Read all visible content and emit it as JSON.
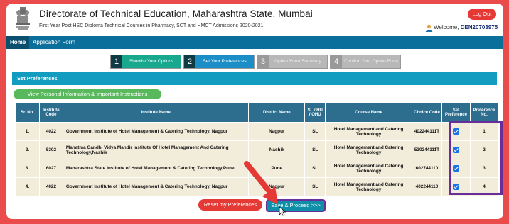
{
  "header": {
    "title": "Directorate of Technical Education, Maharashtra State, Mumbai",
    "subtitle": "First Year Post HSC Diploma Technical Courses in Pharmacy, SCT and HMCT Admissions 2020-2021",
    "logout_label": "Log Out",
    "welcome_label": "Welcome,",
    "user_id": "DEN20703975"
  },
  "nav": {
    "home_label": "Home",
    "application_form_label": "Application Form"
  },
  "steps": [
    {
      "num": "1",
      "label": "Shortlist Your Options",
      "state": "done"
    },
    {
      "num": "2",
      "label": "Set Your Preferences",
      "state": "active"
    },
    {
      "num": "3",
      "label": "Option Form Summary",
      "state": "pending"
    },
    {
      "num": "4",
      "label": "Confirm Your Option Form",
      "state": "pending"
    }
  ],
  "panel": {
    "title": "Set Preferences",
    "instructions_button": "View Personal Information & Important Instructions"
  },
  "table": {
    "headers": [
      "Sr. No.",
      "Institute Code",
      "Institute Name",
      "District Name",
      "SL / HU / OHU",
      "Course Name",
      "Choice Code",
      "Set Preference",
      "Preference No."
    ],
    "rows": [
      {
        "sr": "1.",
        "code": "4022",
        "name": "Government Institute of Hotel Management & Catering Technology, Nagpur",
        "district": "Nagpur",
        "type": "SL",
        "course": "Hotel Management and Catering Technology",
        "choice": "402244111T",
        "checked": true,
        "pref": "1"
      },
      {
        "sr": "2.",
        "code": "5302",
        "name": "Mahatma Gandhi Vidya Mandir Institute Of Hotel Management And Catering Technology,Nashik",
        "district": "Nashik",
        "type": "SL",
        "course": "Hotel Management and Catering Technology",
        "choice": "530244111T",
        "checked": true,
        "pref": "2"
      },
      {
        "sr": "3.",
        "code": "6027",
        "name": "Maharashtra State Institute of Hotel Management & Catering Technology,Pune",
        "district": "Pune",
        "type": "SL",
        "course": "Hotel Management and Catering Technology",
        "choice": "602744110",
        "checked": true,
        "pref": "3"
      },
      {
        "sr": "4.",
        "code": "4022",
        "name": "Government Institute of Hotel Management & Catering Technology, Nagpur",
        "district": "Nagpur",
        "type": "SL",
        "course": "Hotel Management and Catering Technology",
        "choice": "402244110",
        "checked": true,
        "pref": "4"
      }
    ]
  },
  "actions": {
    "reset_label": "Reset my Preferences",
    "save_label": "Save & Proceed >>>"
  },
  "colors": {
    "background": "#ea4b4b",
    "nav": "#0b6f9b",
    "panel": "#129cbf",
    "table_header": "#2d6e8f",
    "highlight": "#6a2e9a"
  }
}
